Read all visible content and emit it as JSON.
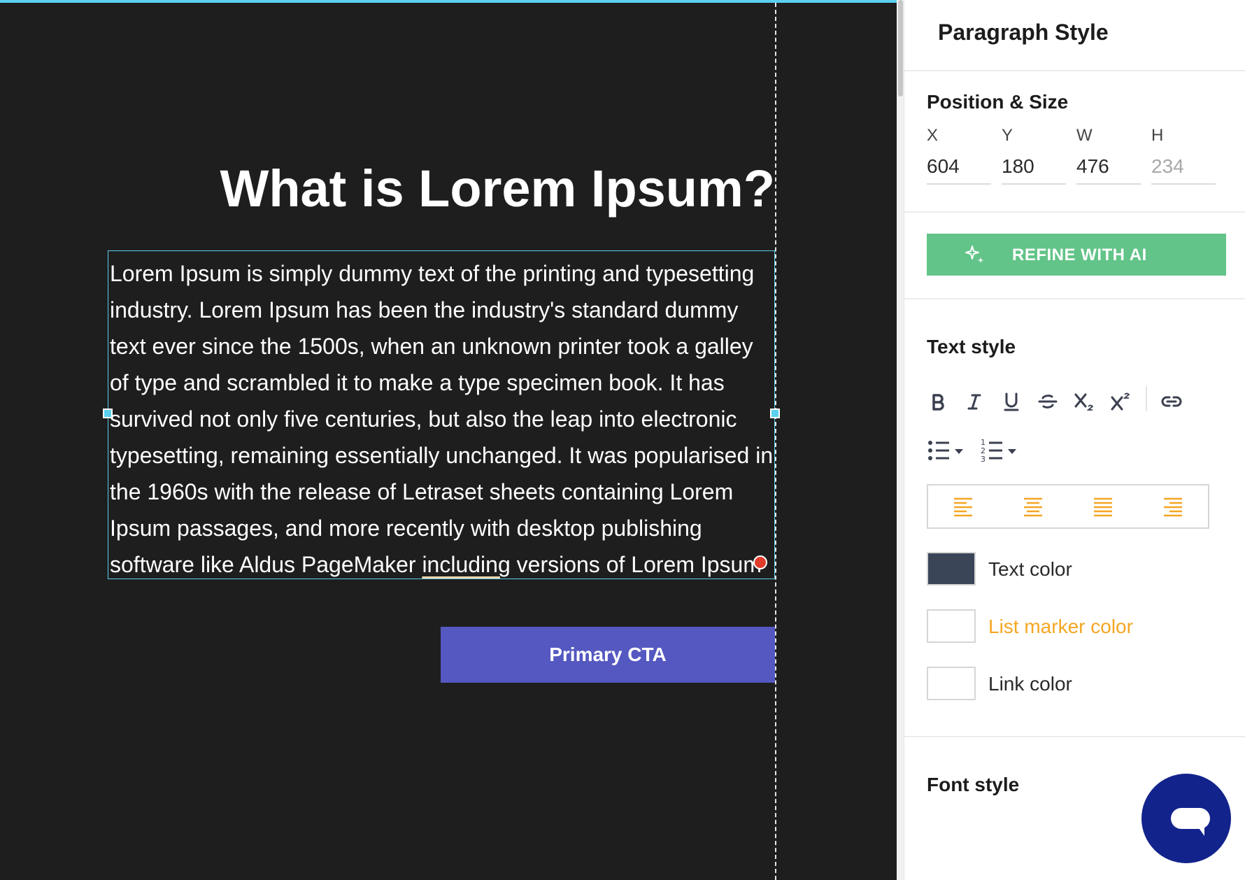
{
  "canvas": {
    "headline": "What is Lorem Ipsum?",
    "paragraph": {
      "before": "Lorem Ipsum is simply dummy text of the printing and typesetting industry. Lorem Ipsum has been the industry's standard dummy text ever since the 1500s, when an unknown printer took a galley of type and scrambled it to make a type specimen book. It has survived not only five centuries, but also the leap into electronic typesetting, remaining essentially unchanged. It was popularised in the 1960s with the release of Letraset sheets containing Lorem Ipsum passages, and more recently with desktop publishing software like Aldus PageMaker ",
      "misspelled": "including",
      "after": " versions of Lorem Ipsum"
    },
    "cta_label": "Primary CTA"
  },
  "panel": {
    "title": "Paragraph Style",
    "position_size": {
      "title": "Position & Size",
      "x": {
        "label": "X",
        "value": "604"
      },
      "y": {
        "label": "Y",
        "value": "180"
      },
      "w": {
        "label": "W",
        "value": "476"
      },
      "h": {
        "label": "H",
        "value": "234"
      }
    },
    "refine_label": "REFINE WITH AI",
    "text_style": {
      "title": "Text style",
      "format_icons": [
        "bold-icon",
        "italic-icon",
        "underline-icon",
        "strikethrough-icon",
        "subscript-icon",
        "superscript-icon",
        "link-icon"
      ],
      "list_icons": [
        "bulleted-list-icon",
        "numbered-list-icon"
      ],
      "align_icons": [
        "align-left-icon",
        "align-center-icon",
        "align-justify-icon",
        "align-right-icon"
      ],
      "colors": {
        "text_color_label": "Text color",
        "text_color_value": "#3a4658",
        "list_marker_color_label": "List marker color",
        "list_marker_color_value": "#ffffff",
        "link_color_label": "Link color",
        "link_color_value": "#ffffff"
      }
    },
    "font_style": {
      "title": "Font style"
    }
  },
  "colors": {
    "canvas_bg": "#1e1e1e",
    "selection": "#5bd0ee",
    "cta": "#5458c0",
    "refine": "#62c488",
    "align_accent": "#f5a623",
    "chat": "#12238c"
  }
}
